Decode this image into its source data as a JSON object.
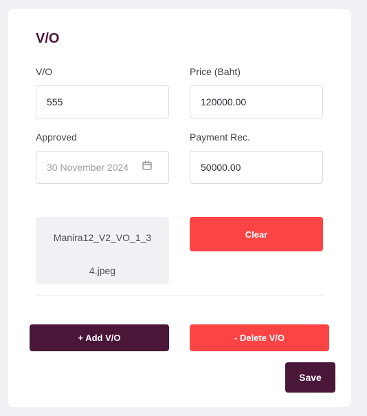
{
  "form": {
    "title": "V/O",
    "vo_label": "V/O",
    "vo_value": "555",
    "price_label": "Price (Baht)",
    "price_value": "120000.00",
    "approved_label": "Approved",
    "approved_value": "30 November 2024",
    "payment_label": "Payment Rec.",
    "payment_value": "50000.00"
  },
  "attachment": {
    "filename_line1": "Manira12_V2_VO_1_3",
    "filename_line2": "4.jpeg"
  },
  "buttons": {
    "clear": "Clear",
    "add_vo": "+ Add V/O",
    "delete_vo": "- Delete V/O",
    "save": "Save"
  },
  "colors": {
    "primary": "#4a1738",
    "danger": "#fc4445",
    "background": "#eff1f4"
  },
  "icons": {
    "date_picker": "calendar-icon"
  }
}
